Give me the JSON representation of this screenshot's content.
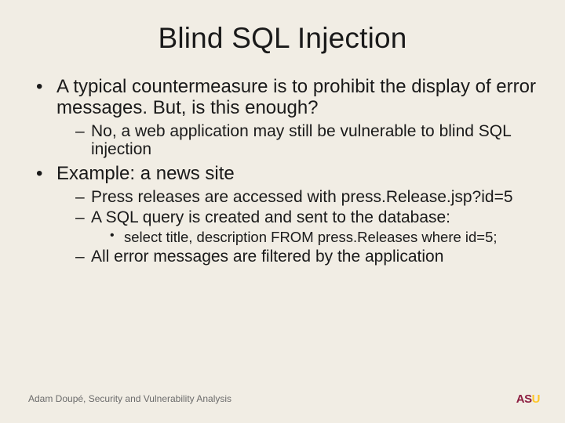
{
  "title": "Blind SQL Injection",
  "bullets": {
    "b1": "A typical countermeasure is to prohibit the display of error messages. But, is this enough?",
    "b1_1": "No, a web application may still be vulnerable to blind SQL injection",
    "b2": "Example: a news site",
    "b2_1": "Press releases are accessed with press.​Release.​jsp?​id=5",
    "b2_2": "A SQL query is created and sent to the database:",
    "b2_2_1": "select title, description FROM press.​Releases where id=5;",
    "b2_3": "All error messages are filtered by the application"
  },
  "footer": "Adam Doupé, Security and Vulnerability Analysis",
  "logo": {
    "a": "A",
    "s": "S",
    "u": "U"
  }
}
